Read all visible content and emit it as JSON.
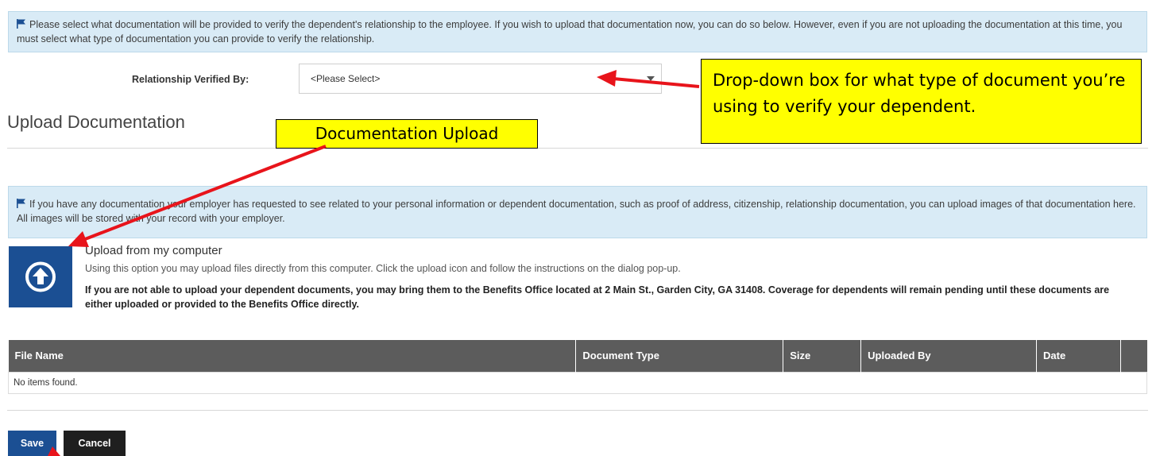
{
  "relationship_info": {
    "text": "Please select what documentation will be provided to verify the dependent's relationship to the employee. If you wish to upload that documentation now, you can do so below. However, even if you are not uploading the documentation at this time, you must select what type of documentation you can provide to verify the relationship."
  },
  "relationship_field": {
    "label": "Relationship Verified By:",
    "selected_value": "<Please Select>"
  },
  "upload_section": {
    "heading": "Upload Documentation",
    "info_text": "If you have any documentation your employer has requested to see related to your personal information or dependent documentation, such as proof of address, citizenship, relationship documentation, you can upload images of that documentation here. All images will be stored with your record with your employer.",
    "option_title": "Upload from my computer",
    "option_description": "Using this option you may upload files directly from this computer. Click the upload icon and follow the instructions on the dialog pop-up.",
    "note": "If you are not able to upload your dependent documents, you may bring them to the Benefits Office located at 2 Main St., Garden City, GA 31408. Coverage for dependents will remain pending until these documents are either uploaded or provided to the Benefits Office directly."
  },
  "files_table": {
    "columns": [
      "File Name",
      "Document Type",
      "Size",
      "Uploaded By",
      "Date",
      ""
    ],
    "empty_message": "No items found."
  },
  "actions": {
    "save_label": "Save",
    "cancel_label": "Cancel"
  },
  "annotations": {
    "dropdown_callout": "Drop-down box for what type of document you’re using to verify your dependent.",
    "upload_callout": "Documentation Upload",
    "arrow_color": "#e8141b",
    "highlight_color": "#ffff00"
  },
  "colors": {
    "info_background": "#d9ebf6",
    "primary_blue": "#1b4f93",
    "table_header": "#5c5c5c"
  },
  "icons": [
    "flag-icon",
    "upload-arrow-icon",
    "dropdown-caret-icon"
  ]
}
